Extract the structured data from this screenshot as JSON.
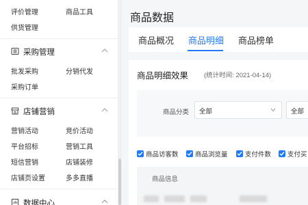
{
  "sidebar": {
    "top_items": [
      {
        "c1": "评价管理",
        "c2": "商品工具"
      },
      {
        "c1": "供货管理",
        "c2": ""
      }
    ],
    "groups": [
      {
        "title": "采购管理",
        "icon": "purchase-icon",
        "rows": [
          {
            "c1": "批发采购",
            "c2": "分销代发"
          },
          {
            "c1": "采购订单",
            "c2": ""
          }
        ]
      },
      {
        "title": "店铺营销",
        "icon": "store-icon",
        "rows": [
          {
            "c1": "营销活动",
            "c2": "竞价活动"
          },
          {
            "c1": "平台招标",
            "c2": "营销工具"
          },
          {
            "c1": "短信营销",
            "c2": "店铺装修"
          },
          {
            "c1": "店铺页设置",
            "c2": "多多直播"
          }
        ]
      },
      {
        "title": "数据中心",
        "icon": "data-center-icon",
        "rows": []
      }
    ]
  },
  "main": {
    "page_title": "商品数据",
    "tabs": [
      {
        "label": "商品概况",
        "active": false
      },
      {
        "label": "商品明细",
        "active": true
      },
      {
        "label": "商品榜单",
        "active": false
      }
    ],
    "card": {
      "title": "商品明细效果",
      "subtitle": "(统计时间: 2021-04-14)",
      "filter_label": "商品分类",
      "select1_value": "全部",
      "select2_value": "全部",
      "checkboxes": [
        "商品访客数",
        "商品浏览量",
        "支付件数",
        "支付买"
      ],
      "table_header": "商品信息"
    }
  },
  "colors": {
    "accent": "#1f7aff",
    "sidebar_bg": "#ffffff",
    "page_bg": "#f5f6f8"
  }
}
